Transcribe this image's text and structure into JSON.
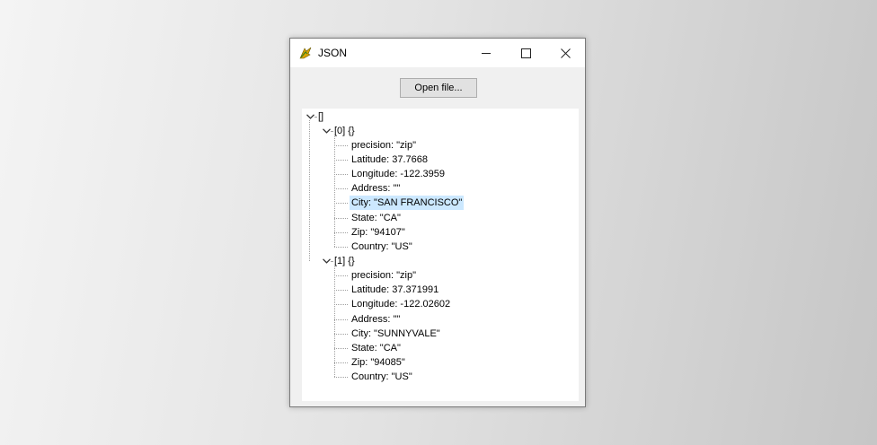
{
  "window": {
    "title": "JSON",
    "icon": "app-icon",
    "controls": {
      "minimize": "minimize-icon",
      "maximize": "maximize-icon",
      "close": "close-icon"
    }
  },
  "toolbar": {
    "open_file_label": "Open file..."
  },
  "tree": {
    "root": {
      "label": "[]",
      "icon": "chevron-down-icon"
    },
    "items": [
      {
        "label": "[0] {}",
        "icon": "chevron-down-icon",
        "children": [
          {
            "text": "precision: \"zip\""
          },
          {
            "text": "Latitude: 37.7668"
          },
          {
            "text": "Longitude: -122.3959"
          },
          {
            "text": "Address: \"\""
          },
          {
            "text": "City: \"SAN FRANCISCO\"",
            "selected": true
          },
          {
            "text": "State: \"CA\""
          },
          {
            "text": "Zip: \"94107\""
          },
          {
            "text": "Country: \"US\""
          }
        ]
      },
      {
        "label": "[1] {}",
        "icon": "chevron-down-icon",
        "children": [
          {
            "text": "precision: \"zip\""
          },
          {
            "text": "Latitude: 37.371991"
          },
          {
            "text": "Longitude: -122.02602"
          },
          {
            "text": "Address: \"\""
          },
          {
            "text": "City: \"SUNNYVALE\""
          },
          {
            "text": "State: \"CA\""
          },
          {
            "text": "Zip: \"94085\""
          },
          {
            "text": "Country: \"US\""
          }
        ]
      }
    ]
  },
  "colors": {
    "selection": "#cce8ff",
    "tree_lines": "#a0a0a0"
  }
}
